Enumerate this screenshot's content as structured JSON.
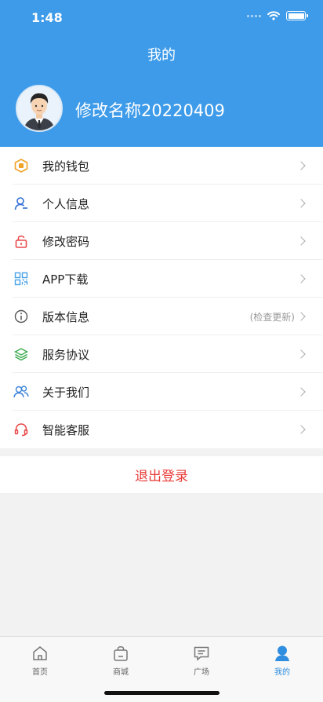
{
  "status": {
    "time": "1:48"
  },
  "header": {
    "title": "我的",
    "username": "修改名称20220409"
  },
  "menu": [
    {
      "label": "我的钱包",
      "icon": "wallet-icon",
      "extra": ""
    },
    {
      "label": "个人信息",
      "icon": "user-icon",
      "extra": ""
    },
    {
      "label": "修改密码",
      "icon": "lock-icon",
      "extra": ""
    },
    {
      "label": "APP下载",
      "icon": "qr-code-icon",
      "extra": ""
    },
    {
      "label": "版本信息",
      "icon": "info-icon",
      "extra": "(检查更新)"
    },
    {
      "label": "服务协议",
      "icon": "layers-icon",
      "extra": ""
    },
    {
      "label": "关于我们",
      "icon": "group-icon",
      "extra": ""
    },
    {
      "label": "智能客服",
      "icon": "headset-icon",
      "extra": ""
    }
  ],
  "logout_label": "退出登录",
  "tabs": [
    {
      "label": "首页",
      "icon": "home-icon"
    },
    {
      "label": "商城",
      "icon": "shopping-bag-icon"
    },
    {
      "label": "广场",
      "icon": "chat-icon"
    },
    {
      "label": "我的",
      "icon": "profile-icon",
      "active": true
    }
  ],
  "colors": {
    "header": "#3d9be9",
    "logout": "#e83a36",
    "active_tab": "#2f8ee0"
  }
}
